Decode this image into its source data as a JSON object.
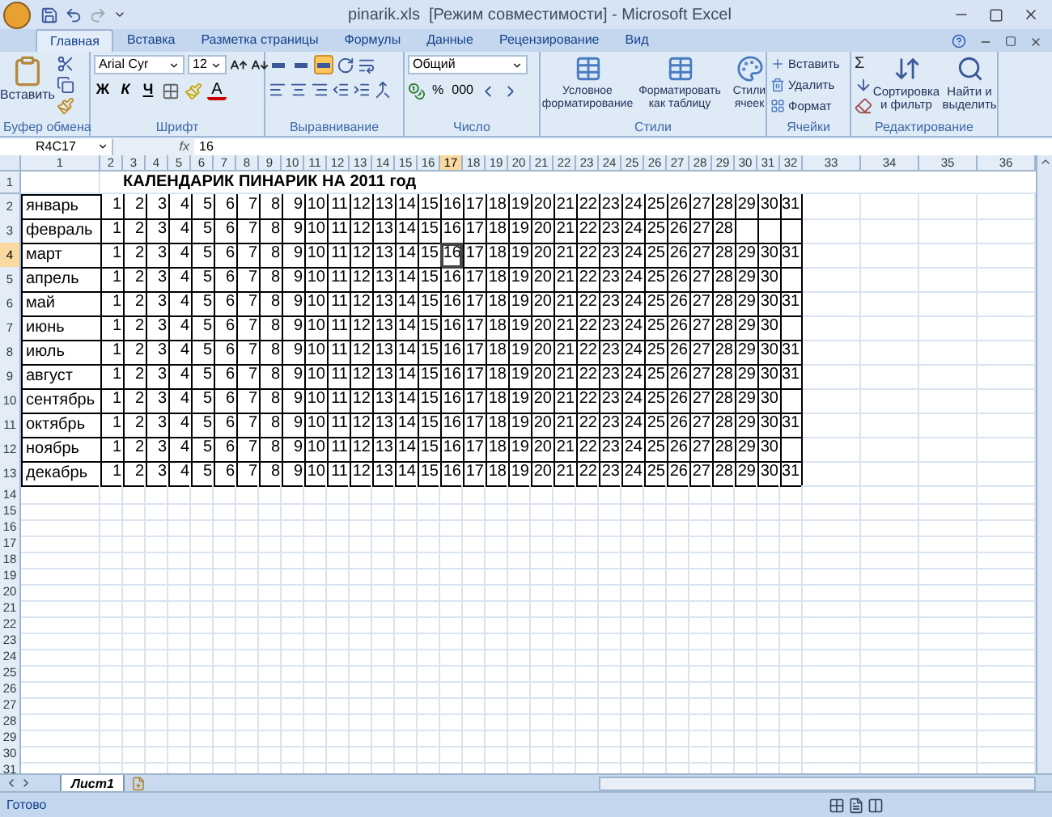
{
  "window": {
    "title": "pinarik.xls  [Режим совместимости] - Microsoft Excel"
  },
  "tabs": [
    {
      "label": "Главная",
      "selected": true
    },
    {
      "label": "Вставка",
      "selected": false
    },
    {
      "label": "Разметка страницы",
      "selected": false
    },
    {
      "label": "Формулы",
      "selected": false
    },
    {
      "label": "Данные",
      "selected": false
    },
    {
      "label": "Рецензирование",
      "selected": false
    },
    {
      "label": "Вид",
      "selected": false
    }
  ],
  "ribbon": {
    "groups": [
      {
        "kind": "clipboard",
        "label": "Буфер обмена",
        "paste": "Вставить"
      },
      {
        "kind": "font",
        "label": "Шрифт",
        "font": "Arial Cyr",
        "size": "12",
        "bold": "Ж",
        "italic": "К",
        "underline": "Ч",
        "color_letter": "A"
      },
      {
        "kind": "alignment",
        "label": "Выравнивание",
        "valign": [
          {
            "selected": false
          },
          {
            "selected": false
          },
          {
            "selected": true
          }
        ]
      },
      {
        "kind": "number",
        "label": "Число",
        "format": "Общий",
        "percent": "%",
        "thousands": "000"
      },
      {
        "kind": "styles",
        "label": "Стили",
        "buttons": [
          "Условное форматирование",
          "Форматировать как таблицу",
          "Стили ячеек"
        ]
      },
      {
        "kind": "cells",
        "label": "Ячейки",
        "buttons": [
          "Вставить",
          "Удалить",
          "Формат"
        ]
      },
      {
        "kind": "editing",
        "label": "Редактирование",
        "sum": "Σ",
        "buttons": [
          "Сортировка и фильтр",
          "Найти и выделить"
        ]
      }
    ]
  },
  "formula_bar": {
    "name_box": "R4C17",
    "fx": "fx",
    "value": "16"
  },
  "sheet": {
    "column_headers": [
      {
        "label": "1",
        "selected": false
      },
      {
        "label": "2",
        "selected": false
      },
      {
        "label": "3",
        "selected": false
      },
      {
        "label": "4",
        "selected": false
      },
      {
        "label": "5",
        "selected": false
      },
      {
        "label": "6",
        "selected": false
      },
      {
        "label": "7",
        "selected": false
      },
      {
        "label": "8",
        "selected": false
      },
      {
        "label": "9",
        "selected": false
      },
      {
        "label": "10",
        "selected": false
      },
      {
        "label": "11",
        "selected": false
      },
      {
        "label": "12",
        "selected": false
      },
      {
        "label": "13",
        "selected": false
      },
      {
        "label": "14",
        "selected": false
      },
      {
        "label": "15",
        "selected": false
      },
      {
        "label": "16",
        "selected": false
      },
      {
        "label": "17",
        "selected": true
      },
      {
        "label": "18",
        "selected": false
      },
      {
        "label": "19",
        "selected": false
      },
      {
        "label": "20",
        "selected": false
      },
      {
        "label": "21",
        "selected": false
      },
      {
        "label": "22",
        "selected": false
      },
      {
        "label": "23",
        "selected": false
      },
      {
        "label": "24",
        "selected": false
      },
      {
        "label": "25",
        "selected": false
      },
      {
        "label": "26",
        "selected": false
      },
      {
        "label": "27",
        "selected": false
      },
      {
        "label": "28",
        "selected": false
      },
      {
        "label": "29",
        "selected": false
      },
      {
        "label": "30",
        "selected": false
      },
      {
        "label": "31",
        "selected": false
      },
      {
        "label": "32",
        "selected": false
      },
      {
        "label": "33",
        "selected": false
      },
      {
        "label": "34",
        "selected": false
      },
      {
        "label": "35",
        "selected": false
      },
      {
        "label": "36",
        "selected": false
      }
    ],
    "rows": [
      {
        "kind": "title",
        "header": "1",
        "selected": false,
        "title": "КАЛЕНДАРИК ПИНАРИК НА 2011 год"
      },
      {
        "kind": "month",
        "header": "2",
        "selected": false,
        "month": "январь",
        "days": [
          "1",
          "2",
          "3",
          "4",
          "5",
          "6",
          "7",
          "8",
          "9",
          "10",
          "11",
          "12",
          "13",
          "14",
          "15",
          "16",
          "17",
          "18",
          "19",
          "20",
          "21",
          "22",
          "23",
          "24",
          "25",
          "26",
          "27",
          "28",
          "29",
          "30",
          "31"
        ]
      },
      {
        "kind": "month",
        "header": "3",
        "selected": false,
        "month": "февраль",
        "days": [
          "1",
          "2",
          "3",
          "4",
          "5",
          "6",
          "7",
          "8",
          "9",
          "10",
          "11",
          "12",
          "13",
          "14",
          "15",
          "16",
          "17",
          "18",
          "19",
          "20",
          "21",
          "22",
          "23",
          "24",
          "25",
          "26",
          "27",
          "28"
        ]
      },
      {
        "kind": "month",
        "header": "4",
        "selected": true,
        "month": "март",
        "days": [
          "1",
          "2",
          "3",
          "4",
          "5",
          "6",
          "7",
          "8",
          "9",
          "10",
          "11",
          "12",
          "13",
          "14",
          "15",
          "16",
          "17",
          "18",
          "19",
          "20",
          "21",
          "22",
          "23",
          "24",
          "25",
          "26",
          "27",
          "28",
          "29",
          "30",
          "31"
        ]
      },
      {
        "kind": "month",
        "header": "5",
        "selected": false,
        "month": "апрель",
        "days": [
          "1",
          "2",
          "3",
          "4",
          "5",
          "6",
          "7",
          "8",
          "9",
          "10",
          "11",
          "12",
          "13",
          "14",
          "15",
          "16",
          "17",
          "18",
          "19",
          "20",
          "21",
          "22",
          "23",
          "24",
          "25",
          "26",
          "27",
          "28",
          "29",
          "30"
        ]
      },
      {
        "kind": "month",
        "header": "6",
        "selected": false,
        "month": "май",
        "days": [
          "1",
          "2",
          "3",
          "4",
          "5",
          "6",
          "7",
          "8",
          "9",
          "10",
          "11",
          "12",
          "13",
          "14",
          "15",
          "16",
          "17",
          "18",
          "19",
          "20",
          "21",
          "22",
          "23",
          "24",
          "25",
          "26",
          "27",
          "28",
          "29",
          "30",
          "31"
        ]
      },
      {
        "kind": "month",
        "header": "7",
        "selected": false,
        "month": "июнь",
        "days": [
          "1",
          "2",
          "3",
          "4",
          "5",
          "6",
          "7",
          "8",
          "9",
          "10",
          "11",
          "12",
          "13",
          "14",
          "15",
          "16",
          "17",
          "18",
          "19",
          "20",
          "21",
          "22",
          "23",
          "24",
          "25",
          "26",
          "27",
          "28",
          "29",
          "30"
        ]
      },
      {
        "kind": "month",
        "header": "8",
        "selected": false,
        "month": "июль",
        "days": [
          "1",
          "2",
          "3",
          "4",
          "5",
          "6",
          "7",
          "8",
          "9",
          "10",
          "11",
          "12",
          "13",
          "14",
          "15",
          "16",
          "17",
          "18",
          "19",
          "20",
          "21",
          "22",
          "23",
          "24",
          "25",
          "26",
          "27",
          "28",
          "29",
          "30",
          "31"
        ]
      },
      {
        "kind": "month",
        "header": "9",
        "selected": false,
        "month": "август",
        "days": [
          "1",
          "2",
          "3",
          "4",
          "5",
          "6",
          "7",
          "8",
          "9",
          "10",
          "11",
          "12",
          "13",
          "14",
          "15",
          "16",
          "17",
          "18",
          "19",
          "20",
          "21",
          "22",
          "23",
          "24",
          "25",
          "26",
          "27",
          "28",
          "29",
          "30",
          "31"
        ]
      },
      {
        "kind": "month",
        "header": "10",
        "selected": false,
        "month": "сентябрь",
        "days": [
          "1",
          "2",
          "3",
          "4",
          "5",
          "6",
          "7",
          "8",
          "9",
          "10",
          "11",
          "12",
          "13",
          "14",
          "15",
          "16",
          "17",
          "18",
          "19",
          "20",
          "21",
          "22",
          "23",
          "24",
          "25",
          "26",
          "27",
          "28",
          "29",
          "30"
        ]
      },
      {
        "kind": "month",
        "header": "11",
        "selected": false,
        "month": "октябрь",
        "days": [
          "1",
          "2",
          "3",
          "4",
          "5",
          "6",
          "7",
          "8",
          "9",
          "10",
          "11",
          "12",
          "13",
          "14",
          "15",
          "16",
          "17",
          "18",
          "19",
          "20",
          "21",
          "22",
          "23",
          "24",
          "25",
          "26",
          "27",
          "28",
          "29",
          "30",
          "31"
        ]
      },
      {
        "kind": "month",
        "header": "12",
        "selected": false,
        "month": "ноябрь",
        "days": [
          "1",
          "2",
          "3",
          "4",
          "5",
          "6",
          "7",
          "8",
          "9",
          "10",
          "11",
          "12",
          "13",
          "14",
          "15",
          "16",
          "17",
          "18",
          "19",
          "20",
          "21",
          "22",
          "23",
          "24",
          "25",
          "26",
          "27",
          "28",
          "29",
          "30"
        ]
      },
      {
        "kind": "month",
        "header": "13",
        "selected": false,
        "month": "декабрь",
        "days": [
          "1",
          "2",
          "3",
          "4",
          "5",
          "6",
          "7",
          "8",
          "9",
          "10",
          "11",
          "12",
          "13",
          "14",
          "15",
          "16",
          "17",
          "18",
          "19",
          "20",
          "21",
          "22",
          "23",
          "24",
          "25",
          "26",
          "27",
          "28",
          "29",
          "30",
          "31"
        ]
      },
      {
        "kind": "empty",
        "header": "14",
        "selected": false
      },
      {
        "kind": "empty",
        "header": "15",
        "selected": false
      },
      {
        "kind": "empty",
        "header": "16",
        "selected": false
      },
      {
        "kind": "empty",
        "header": "17",
        "selected": false
      },
      {
        "kind": "empty",
        "header": "18",
        "selected": false
      },
      {
        "kind": "empty",
        "header": "19",
        "selected": false
      },
      {
        "kind": "empty",
        "header": "20",
        "selected": false
      },
      {
        "kind": "empty",
        "header": "21",
        "selected": false
      },
      {
        "kind": "empty",
        "header": "22",
        "selected": false
      },
      {
        "kind": "empty",
        "header": "23",
        "selected": false
      },
      {
        "kind": "empty",
        "header": "24",
        "selected": false
      },
      {
        "kind": "empty",
        "header": "25",
        "selected": false
      },
      {
        "kind": "empty",
        "header": "26",
        "selected": false
      },
      {
        "kind": "empty",
        "header": "27",
        "selected": false
      },
      {
        "kind": "empty",
        "header": "28",
        "selected": false
      },
      {
        "kind": "empty",
        "header": "29",
        "selected": false
      },
      {
        "kind": "empty",
        "header": "30",
        "selected": false
      },
      {
        "kind": "empty",
        "header": "31",
        "selected": false
      }
    ]
  },
  "sheet_tabs": [
    {
      "label": "Лист1",
      "selected": true
    }
  ],
  "status_bar": {
    "text": "Готово"
  }
}
